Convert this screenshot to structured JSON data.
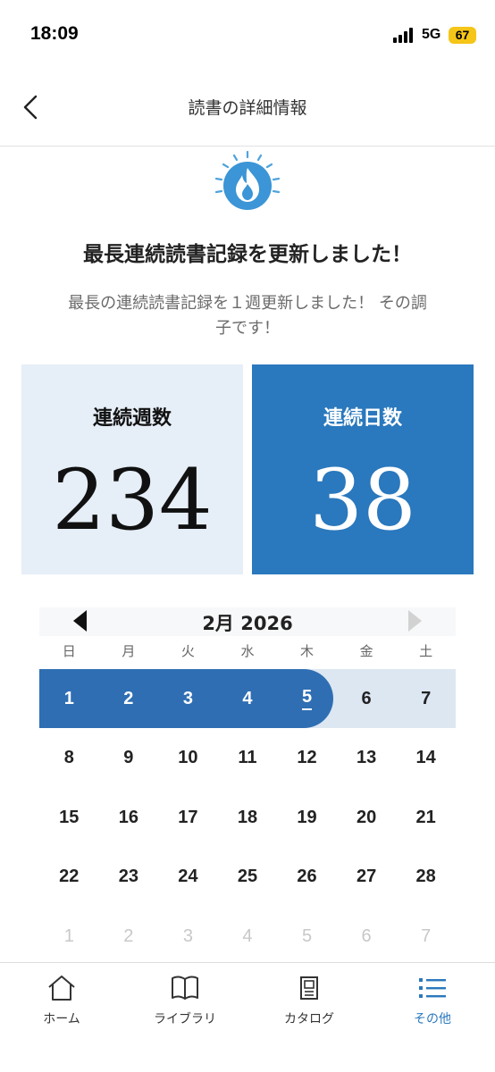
{
  "status_bar": {
    "time": "18:09",
    "network": "5G",
    "battery": "67"
  },
  "header": {
    "title": "読書の詳細情報"
  },
  "headline": "最長連続読書記録を更新しました！",
  "subtext_line1": "最長の連続読書記録を１週更新しました！ その調",
  "subtext_line2": "子です！",
  "stats": {
    "weeks": {
      "label": "連続週数",
      "value": "234"
    },
    "days": {
      "label": "連続日数",
      "value": "38"
    }
  },
  "calendar": {
    "month": "2月 2026",
    "weekdays": [
      "日",
      "月",
      "火",
      "水",
      "木",
      "金",
      "土"
    ],
    "weeks": [
      [
        "1",
        "2",
        "3",
        "4",
        "5",
        "6",
        "7"
      ],
      [
        "8",
        "9",
        "10",
        "11",
        "12",
        "13",
        "14"
      ],
      [
        "15",
        "16",
        "17",
        "18",
        "19",
        "20",
        "21"
      ],
      [
        "22",
        "23",
        "24",
        "25",
        "26",
        "27",
        "28"
      ],
      [
        "1",
        "2",
        "3",
        "4",
        "5",
        "6",
        "7"
      ]
    ]
  },
  "tabs": [
    {
      "label": "ホーム",
      "icon": "home-icon"
    },
    {
      "label": "ライブラリ",
      "icon": "book-icon"
    },
    {
      "label": "カタログ",
      "icon": "catalog-icon"
    },
    {
      "label": "その他",
      "icon": "list-icon"
    }
  ],
  "colors": {
    "accent": "#2a78bd",
    "streak": "#2f6eb3",
    "streak_bg": "#dce7f2",
    "weeks_bg": "#e6eef7",
    "battery": "#f5c518"
  }
}
